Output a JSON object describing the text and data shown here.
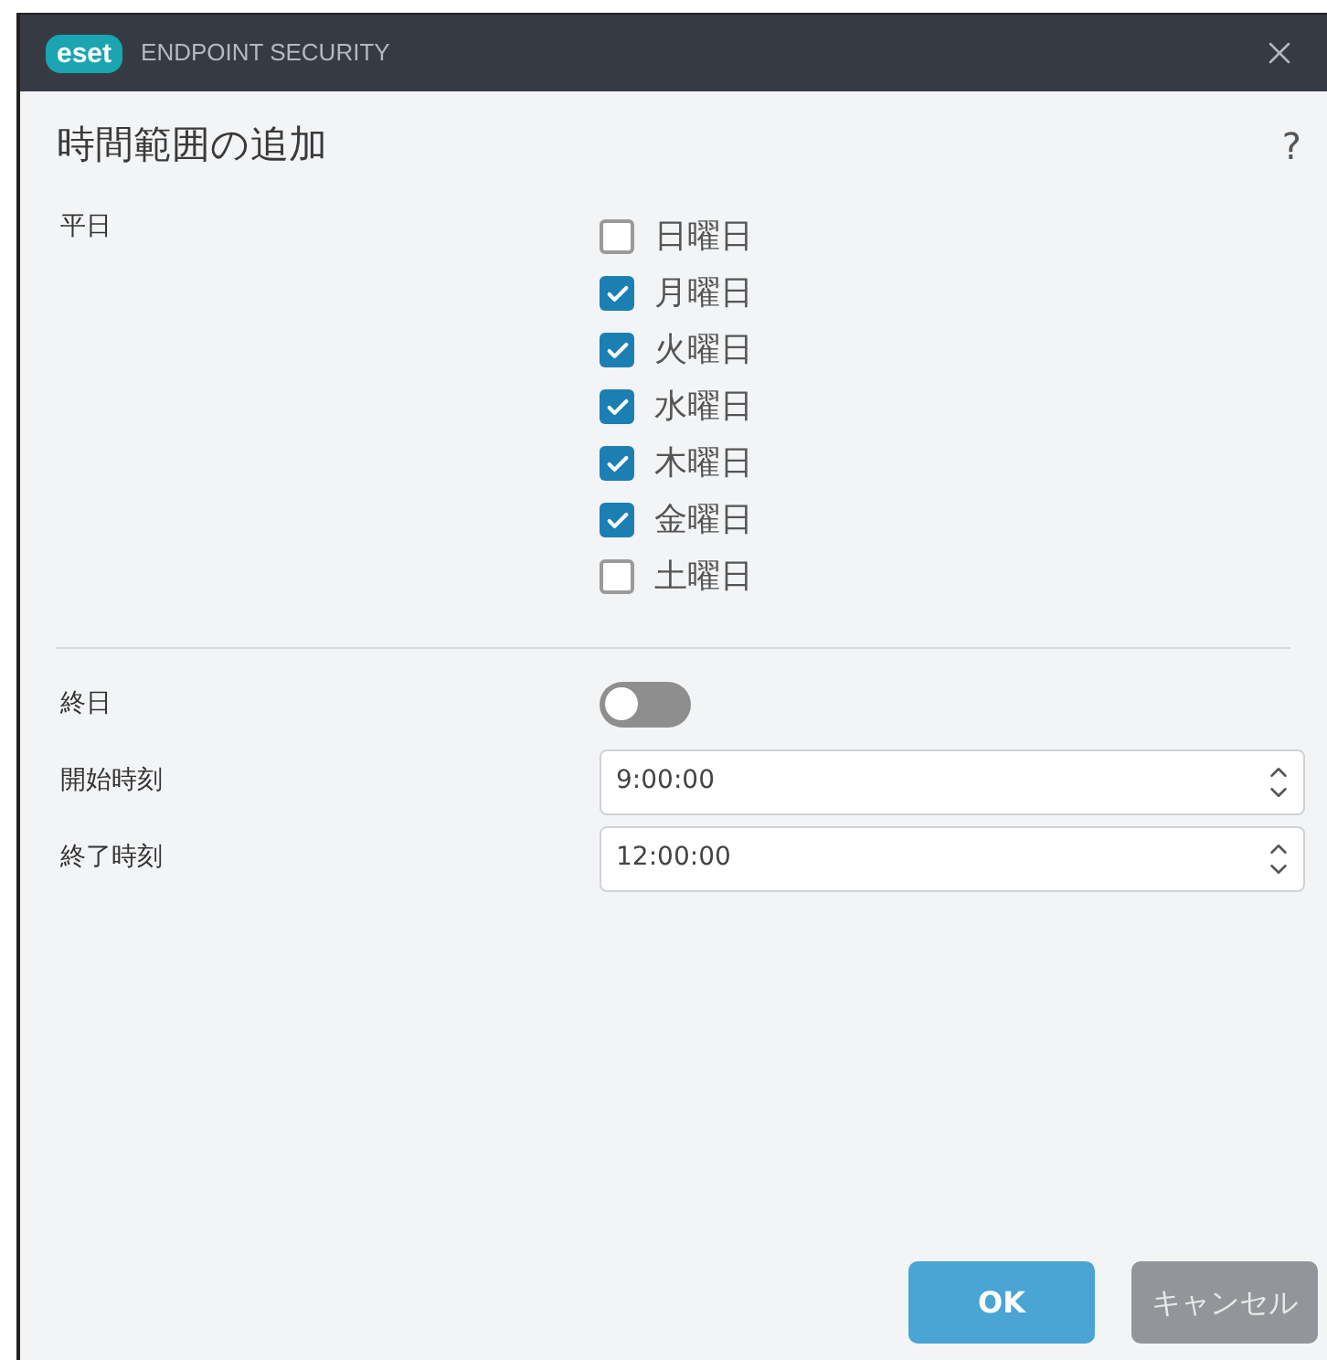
{
  "window": {
    "logo": "eset",
    "title": "ENDPOINT SECURITY"
  },
  "heading": "時間範囲の追加",
  "help": "?",
  "weekdays": {
    "label": "平日",
    "days": [
      {
        "label": "日曜日",
        "checked": false
      },
      {
        "label": "月曜日",
        "checked": true
      },
      {
        "label": "火曜日",
        "checked": true
      },
      {
        "label": "水曜日",
        "checked": true
      },
      {
        "label": "木曜日",
        "checked": true
      },
      {
        "label": "金曜日",
        "checked": true
      },
      {
        "label": "土曜日",
        "checked": false
      }
    ]
  },
  "all_day": {
    "label": "終日",
    "on": false
  },
  "times": [
    {
      "label": "開始時刻",
      "value": "9:00:00"
    },
    {
      "label": "終了時刻",
      "value": "12:00:00"
    }
  ],
  "buttons": [
    {
      "label": "OK",
      "kind": "primary"
    },
    {
      "label": "キャンセル",
      "kind": "secondary"
    }
  ]
}
